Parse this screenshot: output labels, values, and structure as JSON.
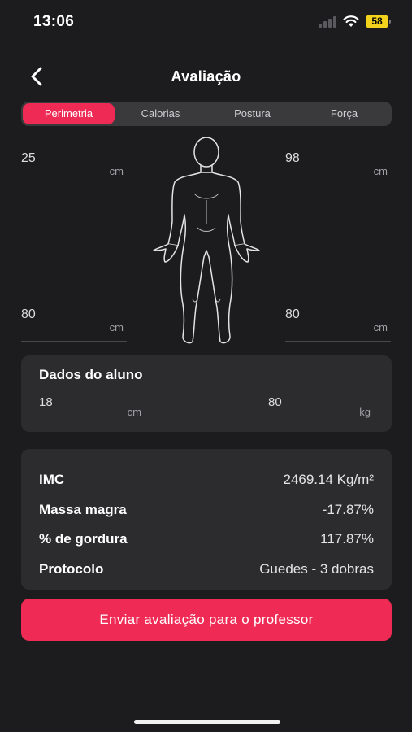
{
  "status_bar": {
    "time": "13:06",
    "battery": "58"
  },
  "nav": {
    "title": "Avaliação",
    "back_icon": "chevron-left-icon"
  },
  "tabs": [
    {
      "label": "Perimetria",
      "active": true
    },
    {
      "label": "Calorias",
      "active": false
    },
    {
      "label": "Postura",
      "active": false
    },
    {
      "label": "Força",
      "active": false
    }
  ],
  "perimetria": {
    "top_left": {
      "value": "25",
      "unit": "cm"
    },
    "top_right": {
      "value": "98",
      "unit": "cm"
    },
    "bottom_left": {
      "value": "80",
      "unit": "cm"
    },
    "bottom_right": {
      "value": "80",
      "unit": "cm"
    }
  },
  "dados_aluno": {
    "title": "Dados do aluno",
    "field1": {
      "value": "18",
      "unit": "cm"
    },
    "field2": {
      "value": "80",
      "unit": "kg"
    }
  },
  "results": {
    "imc": {
      "label": "IMC",
      "value": "2469.14 Kg/m²"
    },
    "massa_magra": {
      "label": "Massa magra",
      "value": "-17.87%"
    },
    "gordura": {
      "label": "% de gordura",
      "value": "117.87%"
    },
    "protocolo": {
      "label": "Protocolo",
      "value": "Guedes - 3 dobras"
    }
  },
  "send_button": {
    "label": "Enviar avaliação para o professor"
  },
  "colors": {
    "accent": "#ee2a55",
    "background": "#1c1c1e",
    "card": "#2c2c2e"
  }
}
